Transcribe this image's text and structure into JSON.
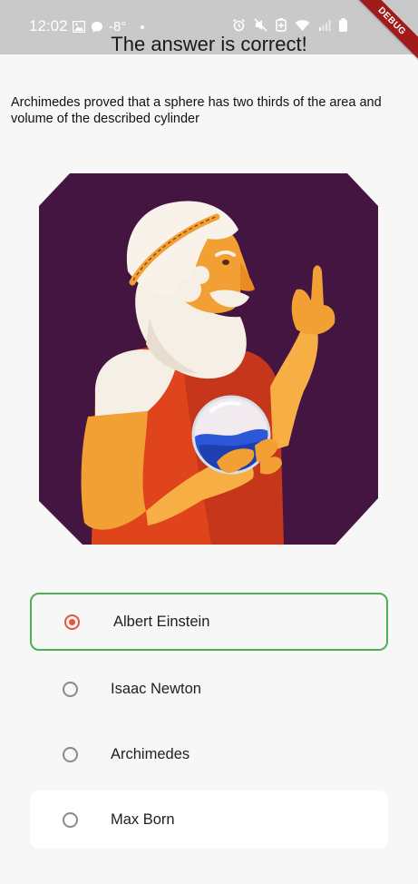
{
  "status_bar": {
    "time": "12:02",
    "temperature": "-8°"
  },
  "debug_banner": "DEBUG",
  "page": {
    "title": "The answer is correct!",
    "question": "Archimedes proved that a sphere has two thirds of the area and volume of the described cylinder"
  },
  "options": [
    {
      "label": "Albert Einstein",
      "selected": true
    },
    {
      "label": "Isaac Newton",
      "selected": false
    },
    {
      "label": "Archimedes",
      "selected": false
    },
    {
      "label": "Max Born",
      "selected": false
    }
  ],
  "colors": {
    "correct_border": "#4caf50",
    "radio_accent": "#e8553a",
    "illustration_bg": "#441540"
  }
}
